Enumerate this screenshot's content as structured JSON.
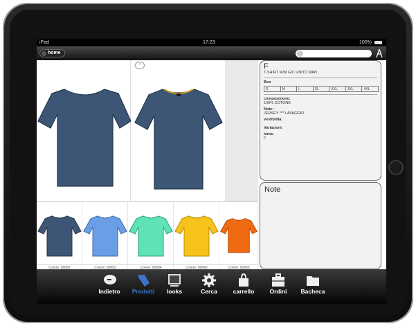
{
  "status": {
    "device": "iPad",
    "time": "17:23",
    "battery": "100%"
  },
  "topbar": {
    "home_label": "home",
    "search_placeholder": ""
  },
  "product": {
    "code": "F",
    "name": "T-SHIRT M/M G/C UNITO MAN",
    "box_label": "Box",
    "sizes": [
      "S",
      "M",
      "L",
      "XL",
      "XXL",
      "3XL",
      "4XL"
    ],
    "composizione_label": "composizione:",
    "composizione_value": "100% COTONE",
    "note_label": "Note:",
    "note_value": "JERSEY *** LAVAGGIO",
    "vestibilita_label": "vestibilità:",
    "variazioni_label": "Variazioni:",
    "tema_label": "tema:",
    "tema_value": "F"
  },
  "note_panel": {
    "title": "Note"
  },
  "colors": {
    "main_shirt": "#3d5676",
    "variants": [
      {
        "caption": "Colore: 00062",
        "hex": "#3d5676"
      },
      {
        "caption": "Colore: 00092",
        "hex": "#6a9fe6"
      },
      {
        "caption": "Colore: 00094",
        "hex": "#5fe2b8"
      },
      {
        "caption": "Colore: 00643",
        "hex": "#f7c21a"
      },
      {
        "caption": "Colore: 00955",
        "hex": "#f06a12"
      }
    ]
  },
  "tabs": [
    {
      "label": "Indietro",
      "icon": "back-arrow-icon"
    },
    {
      "label": "Prodotti",
      "icon": "tag-icon"
    },
    {
      "label": "looks",
      "icon": "monitor-icon"
    },
    {
      "label": "Cerca",
      "icon": "gear-icon"
    },
    {
      "label": "carrello",
      "icon": "bag-icon"
    },
    {
      "label": "Ordini",
      "icon": "briefcase-icon"
    },
    {
      "label": "Bacheca",
      "icon": "folder-icon"
    }
  ]
}
